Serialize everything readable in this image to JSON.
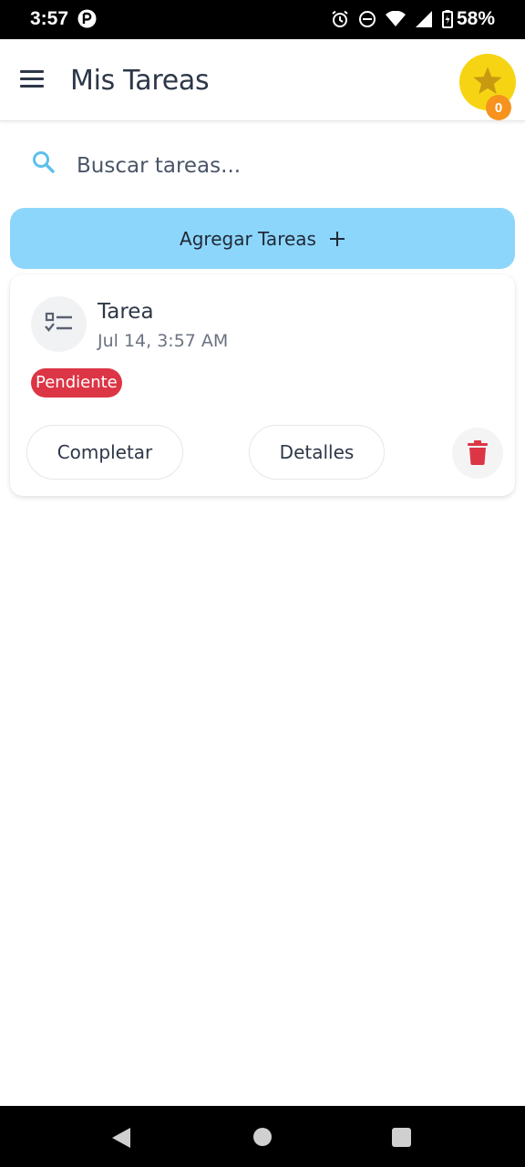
{
  "status_bar": {
    "time": "3:57",
    "battery": "58%",
    "icons": [
      "app-notification-icon",
      "alarm-icon",
      "do-not-disturb-icon",
      "wifi-icon",
      "signal-icon",
      "battery-charging-icon"
    ]
  },
  "app_bar": {
    "title": "Mis Tareas",
    "menu_icon": "hamburger-menu-icon",
    "star_icon": "star-icon",
    "star_count": "0"
  },
  "search": {
    "icon": "search-icon",
    "placeholder": "Buscar tareas...",
    "value": ""
  },
  "add_button": {
    "label": "Agregar Tareas",
    "icon": "plus-icon"
  },
  "tasks": [
    {
      "icon": "checklist-icon",
      "title": "Tarea",
      "date": "Jul 14, 3:57 AM",
      "status": "Pendiente",
      "complete_label": "Completar",
      "details_label": "Detalles",
      "delete_icon": "trash-icon"
    }
  ],
  "nav_bar": {
    "icons": [
      "back-icon",
      "home-icon",
      "recent-apps-icon"
    ]
  },
  "colors": {
    "accent": "#8dd6fb",
    "star_bg": "#f6d413",
    "star_badge": "#f6921e",
    "status_pending": "#dc3545",
    "delete": "#dc3545",
    "search_icon": "#5bc0eb"
  }
}
